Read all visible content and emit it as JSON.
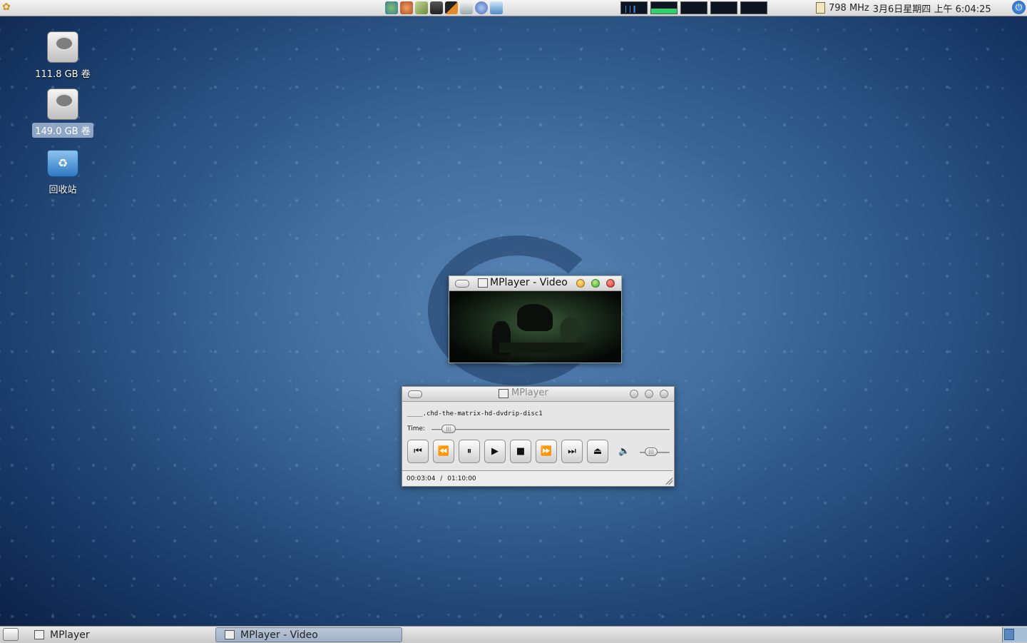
{
  "top_panel": {
    "cpu_freq": "798 MHz",
    "datetime": "3月6日星期四 上午 6:04:25",
    "launcher_icons": [
      "network-icon",
      "gimp-icon",
      "wine-icon",
      "terminal-icon",
      "inkscape-icon",
      "files-icon",
      "browser-icon",
      "image-viewer-icon"
    ],
    "monitor_icons": [
      "network-monitor",
      "cpu-monitor",
      "memory-monitor",
      "swap-monitor",
      "load-monitor"
    ]
  },
  "desktop": {
    "icons": [
      {
        "label": "111.8 GB 卷",
        "icon": "hard-drive-icon"
      },
      {
        "label": "149.0 GB 卷",
        "icon": "hard-drive-icon",
        "selected": true
      },
      {
        "label": "回收站",
        "icon": "trash-icon"
      }
    ]
  },
  "video_window": {
    "title": "MPlayer - Video"
  },
  "control_window": {
    "title": "MPlayer",
    "filename": "____.chd-the-matrix-hd-dvdrip-disc1",
    "time_label": "Time:",
    "current_time": "00:03:04",
    "separator": "/",
    "total_time": "01:10:00",
    "seek_fraction": 0.044,
    "buttons": [
      "previous",
      "rewind",
      "pause",
      "play",
      "stop",
      "fast-forward",
      "next",
      "eject"
    ]
  },
  "taskbar": {
    "tasks": [
      {
        "label": "MPlayer",
        "active": false
      },
      {
        "label": "MPlayer - Video",
        "active": true
      }
    ]
  },
  "colors": {
    "desktop_bg": "#3d6a9b",
    "close_button": "#e0433a",
    "minimize_button": "#f0b030",
    "maximize_button": "#5fc53d",
    "active_task": "#a8b8cc"
  }
}
